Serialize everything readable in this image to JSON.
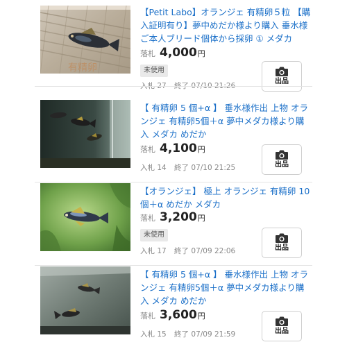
{
  "listings": [
    {
      "title": "【Petit Labo】オランジェ 有精卵５粒 【購入証明有り】夢中めだか様より購入 垂水様ご本人ブリード個体から採卵 ① メダカ",
      "price_label": "落札",
      "price": "4,000",
      "currency": "円",
      "condition": "未使用",
      "bids": "入札 27",
      "end": "終了 07/10 21:26",
      "image_watermark": "有精卵",
      "button_label": "出品",
      "icon": "camera-icon"
    },
    {
      "title": "【 有精卵 5 個+α 】 垂水様作出 上物 オランジェ 有精卵5個＋α 夢中メダカ様より購入 メダカ めだか",
      "price_label": "落札",
      "price": "4,100",
      "currency": "円",
      "bids": "入札 14",
      "end": "終了 07/10 21:25",
      "button_label": "出品",
      "icon": "camera-icon"
    },
    {
      "title": "【オランジェ】 極上 オランジェ 有精卵 10個＋α めだか メダカ",
      "price_label": "落札",
      "price": "3,200",
      "currency": "円",
      "condition": "未使用",
      "bids": "入札 17",
      "end": "終了 07/09 22:06",
      "button_label": "出品",
      "icon": "camera-icon"
    },
    {
      "title": "【 有精卵 5 個+α 】 垂水様作出 上物 オランジェ 有精卵5個＋α 夢中メダカ様より購入 メダカ めだか",
      "price_label": "落札",
      "price": "3,600",
      "currency": "円",
      "bids": "入札 15",
      "end": "終了 07/09 21:59",
      "button_label": "出品",
      "icon": "camera-icon"
    }
  ],
  "colors": {
    "link": "#1a6fc8",
    "price": "#222222",
    "muted": "#888888",
    "badge_bg": "#e9e9e9"
  }
}
